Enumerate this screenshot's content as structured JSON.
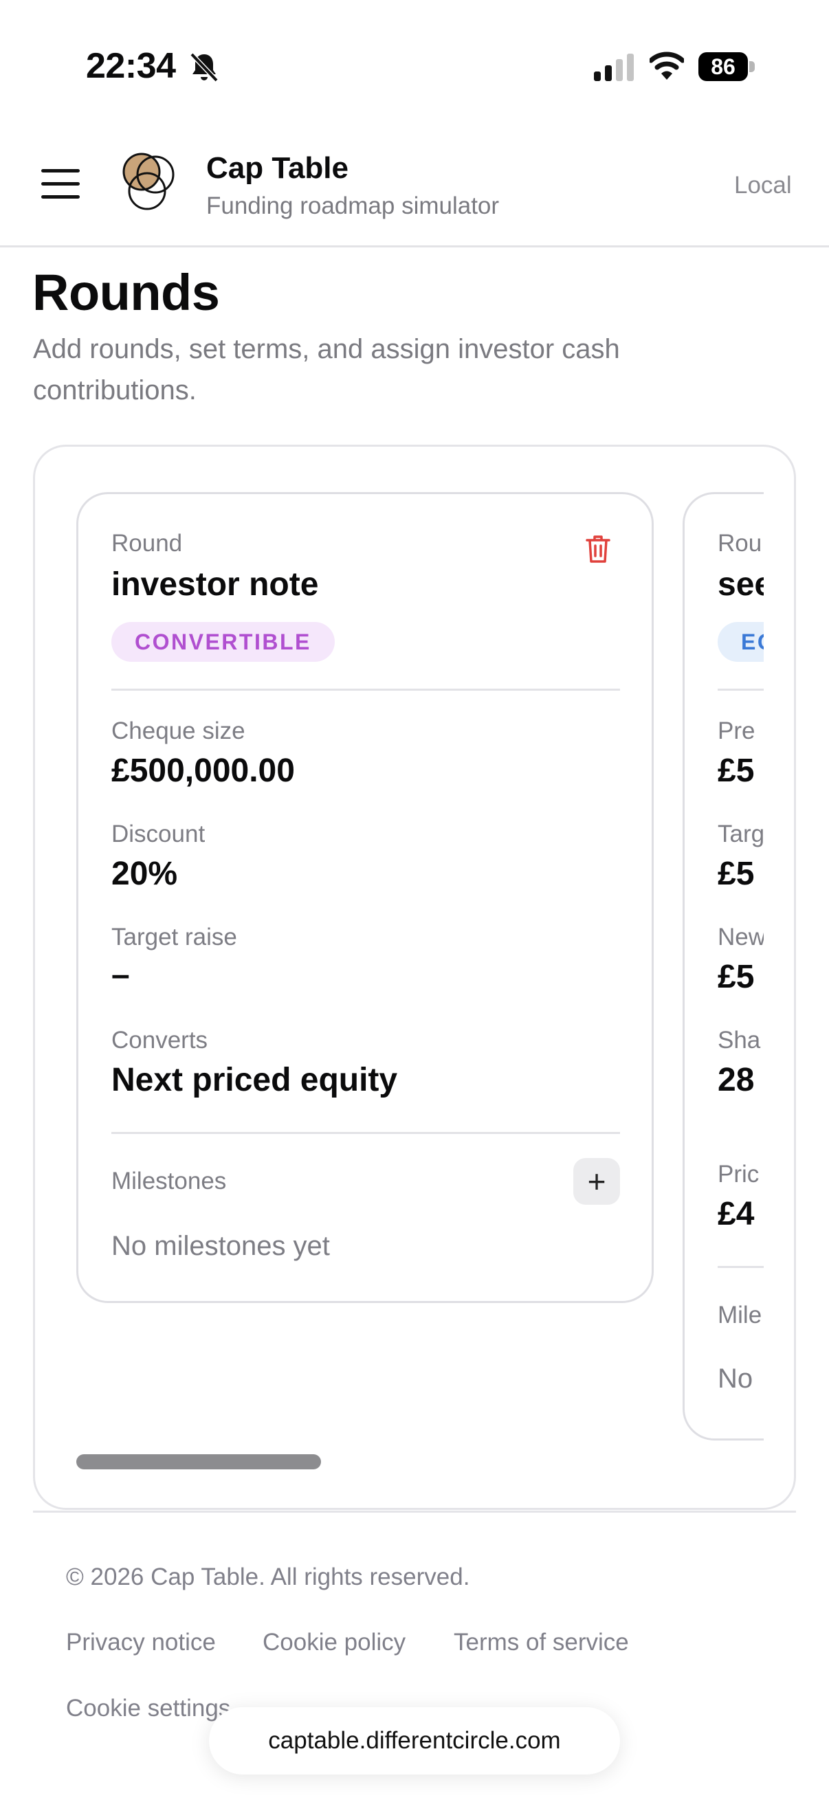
{
  "status_bar": {
    "time": "22:34",
    "battery": "86",
    "icons": [
      "bell-slash-icon",
      "cellular-signal-icon",
      "wifi-icon",
      "battery-icon"
    ]
  },
  "header": {
    "menu_icon": "hamburger-menu-icon",
    "logo_icon": "overlapping-circles-logo-icon",
    "title": "Cap Table",
    "subtitle": "Funding roadmap simulator",
    "storage_label": "Local"
  },
  "page": {
    "title": "Rounds",
    "description": "Add rounds, set terms, and assign investor cash contributions."
  },
  "rounds": [
    {
      "round_label": "Round",
      "name": "investor note",
      "type_badge": "CONVERTIBLE",
      "fields": [
        {
          "label": "Cheque size",
          "value": "£500,000.00"
        },
        {
          "label": "Discount",
          "value": "20%"
        },
        {
          "label": "Target raise",
          "value": "–"
        },
        {
          "label": "Converts",
          "value": "Next priced equity"
        }
      ],
      "milestones_label": "Milestones",
      "milestones_empty": "No milestones yet",
      "delete_icon": "trash-icon",
      "add_icon": "plus-icon"
    },
    {
      "round_label": "Rou",
      "name": "see",
      "type_badge": "EQ",
      "fields": [
        {
          "label": "Pre",
          "value": "£5"
        },
        {
          "label": "Targ",
          "value": "£5"
        },
        {
          "label": "New",
          "value": "£5"
        },
        {
          "label": "Sha",
          "value": "28"
        },
        {
          "label": "Pric",
          "value": "£4"
        }
      ],
      "milestones_label": "Mile",
      "milestones_empty": "No"
    }
  ],
  "footer": {
    "copyright": "© 2026 Cap Table. All rights reserved.",
    "links": [
      "Privacy notice",
      "Cookie policy",
      "Terms of service",
      "Cookie settings"
    ]
  },
  "browser": {
    "url": "captable.differentcircle.com"
  },
  "colors": {
    "convertible_badge_bg": "#f5e7fb",
    "convertible_badge_text": "#b04fd0",
    "equity_badge_bg": "#e5effb",
    "equity_badge_text": "#3a79d6",
    "delete_red": "#e0413c",
    "logo_tan": "#c9a47a"
  }
}
